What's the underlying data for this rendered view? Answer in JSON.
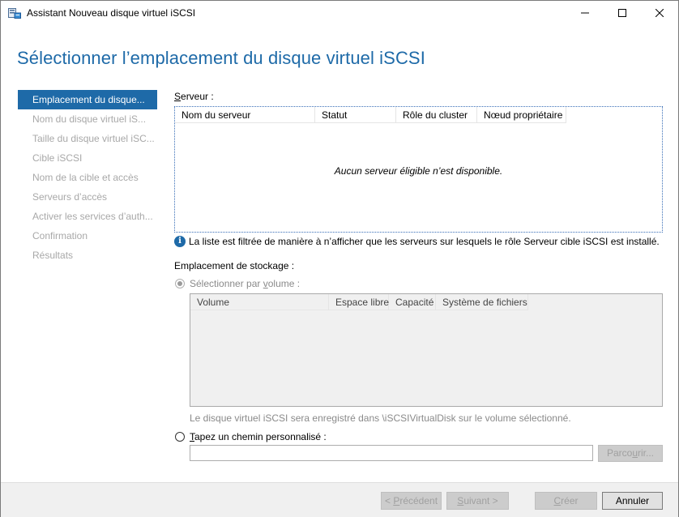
{
  "window": {
    "title": "Assistant Nouveau disque virtuel iSCSI"
  },
  "header": {
    "page_title": "Sélectionner l’emplacement du disque virtuel iSCSI"
  },
  "nav": {
    "items": [
      {
        "label": "Emplacement du disque...",
        "active": true
      },
      {
        "label": "Nom du disque virtuel iS...",
        "active": false
      },
      {
        "label": "Taille du disque virtuel iSC...",
        "active": false
      },
      {
        "label": "Cible iSCSI",
        "active": false
      },
      {
        "label": "Nom de la cible et accès",
        "active": false
      },
      {
        "label": "Serveurs d’accès",
        "active": false
      },
      {
        "label": "Activer les services d’auth...",
        "active": false
      },
      {
        "label": "Confirmation",
        "active": false
      },
      {
        "label": "Résultats",
        "active": false
      }
    ]
  },
  "server": {
    "label_u": "S",
    "label_rest": "erveur :",
    "columns": [
      "Nom du serveur",
      "Statut",
      "Rôle du cluster",
      "Nœud propriétaire"
    ],
    "empty_message": "Aucun serveur éligible n’est disponible.",
    "info_text": "La liste est filtrée de manière à n’afficher que les serveurs sur lesquels le rôle Serveur cible iSCSI est installé."
  },
  "storage": {
    "label": "Emplacement de stockage :",
    "by_volume_pre": "Sélectionner par ",
    "by_volume_u": "v",
    "by_volume_post": "olume :",
    "volume_columns": [
      "Volume",
      "Espace libre",
      "Capacité",
      "Système de fichiers"
    ],
    "volume_note": "Le disque virtuel iSCSI sera enregistré dans \\iSCSIVirtualDisk sur le volume sélectionné.",
    "custom_path_u": "T",
    "custom_path_rest": "apez un chemin personnalisé :",
    "custom_path_value": "",
    "browse_pre": "Parco",
    "browse_u": "u",
    "browse_post": "rir..."
  },
  "footer": {
    "prev_pre": "< ",
    "prev_u": "P",
    "prev_post": "récédent",
    "next_pre": "",
    "next_u": "S",
    "next_post": "uivant >",
    "create_u": "C",
    "create_post": "réer",
    "cancel": "Annuler"
  }
}
